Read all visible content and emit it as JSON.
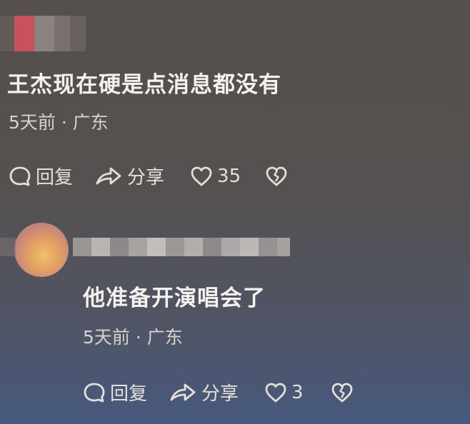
{
  "comments": [
    {
      "text": "王杰现在硬是点消息都没有",
      "meta": "5天前 · 广东",
      "reply_label": "回复",
      "share_label": "分享",
      "like_count": "35",
      "icons": [
        "comment-bubble-icon",
        "share-arrow-icon",
        "heart-icon",
        "broken-heart-icon"
      ]
    },
    {
      "text": "他准备开演唱会了",
      "meta": "5天前 · 广东",
      "reply_label": "回复",
      "share_label": "分享",
      "like_count": "3",
      "icons": [
        "comment-bubble-icon",
        "share-arrow-icon",
        "heart-icon",
        "broken-heart-icon"
      ]
    }
  ],
  "colors": {
    "text": "#f4f1ee",
    "meta": "#d8d2cd",
    "bg_top": "#55504d",
    "bg_bottom": "#47597e"
  }
}
